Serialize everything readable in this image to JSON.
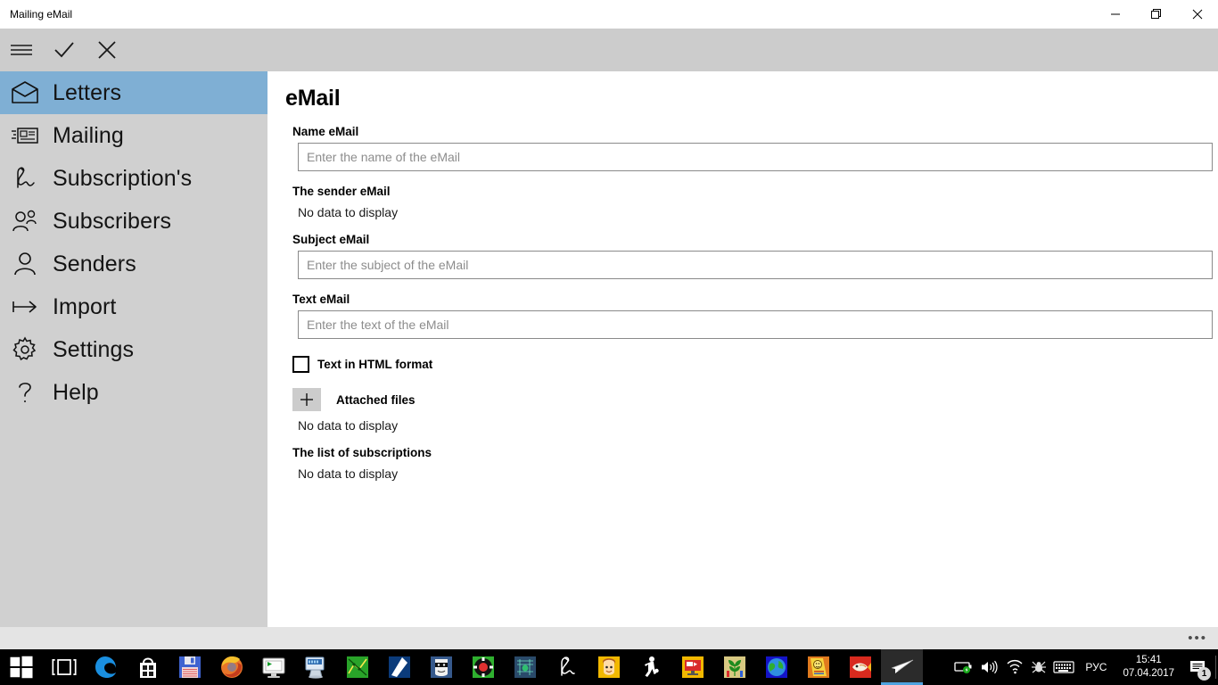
{
  "window": {
    "title": "Mailing eMail",
    "controls": {
      "minimize": "minimize-icon",
      "maximize": "restore-icon",
      "close": "close-icon"
    }
  },
  "toolbar": {
    "buttons": [
      {
        "name": "hamburger-menu-button",
        "icon": "hamburger-icon"
      },
      {
        "name": "confirm-button",
        "icon": "check-icon"
      },
      {
        "name": "cancel-button",
        "icon": "close-icon"
      }
    ]
  },
  "sidebar": {
    "items": [
      {
        "label": "Letters",
        "icon": "envelope-open-icon",
        "selected": true
      },
      {
        "label": "Mailing",
        "icon": "mailing-list-icon",
        "selected": false
      },
      {
        "label": "Subscription's",
        "icon": "signature-icon",
        "selected": false
      },
      {
        "label": "Subscribers",
        "icon": "people-icon",
        "selected": false
      },
      {
        "label": "Senders",
        "icon": "person-icon",
        "selected": false
      },
      {
        "label": "Import",
        "icon": "import-arrow-icon",
        "selected": false
      },
      {
        "label": "Settings",
        "icon": "gear-icon",
        "selected": false
      },
      {
        "label": "Help",
        "icon": "question-mark-icon",
        "selected": false
      }
    ],
    "selected_color": "#7fafd4",
    "background_color": "#d0d0d0"
  },
  "content": {
    "title": "eMail",
    "fields": {
      "name_label": "Name eMail",
      "name_placeholder": "Enter the name of the eMail",
      "name_value": "",
      "sender_label": "The sender eMail",
      "sender_empty": "No data to display",
      "subject_label": "Subject eMail",
      "subject_placeholder": "Enter the subject of the eMail",
      "subject_value": "",
      "text_label": "Text eMail",
      "text_placeholder": "Enter the text of the eMail",
      "text_value": "",
      "html_checkbox_label": "Text in HTML format",
      "html_checkbox_checked": false,
      "attached_files_label": "Attached files",
      "attached_add_icon": "plus-icon",
      "attached_empty": "No data to display",
      "subscriptions_label": "The list of subscriptions",
      "subscriptions_empty": "No data to display"
    }
  },
  "statusbar": {
    "overflow": "•••"
  },
  "taskbar": {
    "start": {
      "name": "start-button",
      "icon": "windows-logo-icon"
    },
    "task_view": {
      "name": "task-view-button",
      "icon": "task-view-icon"
    },
    "apps": [
      {
        "name": "taskbar-edge",
        "icon": "edge-icon"
      },
      {
        "name": "taskbar-store",
        "icon": "store-icon"
      },
      {
        "name": "taskbar-save",
        "icon": "floppy-disk-icon"
      },
      {
        "name": "taskbar-firefox",
        "icon": "firefox-icon"
      },
      {
        "name": "taskbar-monitor",
        "icon": "monitor-play-icon"
      },
      {
        "name": "taskbar-remote",
        "icon": "remote-desktop-icon"
      },
      {
        "name": "taskbar-green-app",
        "icon": "green-chart-icon"
      },
      {
        "name": "taskbar-blue-app",
        "icon": "blue-arrow-icon"
      },
      {
        "name": "taskbar-mask-app",
        "icon": "masked-face-icon"
      },
      {
        "name": "taskbar-casino",
        "icon": "poker-chip-icon"
      },
      {
        "name": "taskbar-circuit",
        "icon": "circuit-board-icon"
      },
      {
        "name": "taskbar-signature",
        "icon": "signature-icon"
      },
      {
        "name": "taskbar-avatar",
        "icon": "girl-face-icon"
      },
      {
        "name": "taskbar-walker",
        "icon": "walking-person-icon"
      },
      {
        "name": "taskbar-video",
        "icon": "video-screen-icon"
      },
      {
        "name": "taskbar-plant",
        "icon": "plant-leaf-icon"
      },
      {
        "name": "taskbar-globe",
        "icon": "globe-icon"
      },
      {
        "name": "taskbar-smiley",
        "icon": "smiley-card-icon"
      },
      {
        "name": "taskbar-fish",
        "icon": "fish-icon"
      },
      {
        "name": "taskbar-mailing",
        "icon": "paper-plane-icon",
        "active": true
      }
    ],
    "tray": [
      {
        "name": "tray-battery",
        "icon": "battery-icon"
      },
      {
        "name": "tray-volume",
        "icon": "speaker-icon"
      },
      {
        "name": "tray-network",
        "icon": "wifi-icon"
      },
      {
        "name": "tray-spider",
        "icon": "spider-icon"
      },
      {
        "name": "tray-keyboard",
        "icon": "keyboard-icon"
      }
    ],
    "language": "РУС",
    "clock_time": "15:41",
    "clock_date": "07.04.2017",
    "action_center": {
      "name": "action-center-button",
      "icon": "notification-icon",
      "badge": "1"
    }
  }
}
